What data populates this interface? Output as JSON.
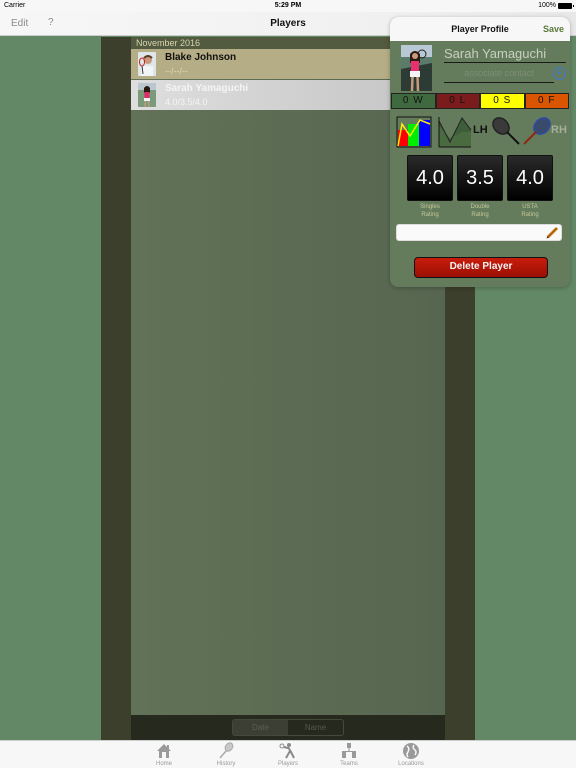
{
  "status_bar": {
    "carrier": "Carrier",
    "time": "5:29 PM",
    "battery": "100%"
  },
  "nav_bar": {
    "edit_label": "Edit",
    "help_label": "?",
    "title": "Players"
  },
  "list": {
    "section_header": "November 2016",
    "rows": [
      {
        "name": "Blake Johnson",
        "subtitle": "--/--/--"
      },
      {
        "name": "Sarah Yamaguchi",
        "subtitle": "4.0/3.5/4.0"
      }
    ]
  },
  "sort_control": {
    "options": [
      "Date",
      "Name"
    ],
    "selected": "Date"
  },
  "tab_bar": {
    "tabs": [
      {
        "label": "Home",
        "icon": "home-icon"
      },
      {
        "label": "History",
        "icon": "racket-icon"
      },
      {
        "label": "Players",
        "icon": "player-icon"
      },
      {
        "label": "Teams",
        "icon": "teams-icon"
      },
      {
        "label": "Locations",
        "icon": "globe-icon"
      }
    ],
    "selected": "Players"
  },
  "profile": {
    "title": "Player Profile",
    "save_label": "Save",
    "name": "Sarah Yamaguchi",
    "contact_placeholder": "associate contact",
    "record": {
      "wins": "0 W",
      "losses": "0 L",
      "sets": "0 S",
      "forfeits": "0 F"
    },
    "record_colors": {
      "wins": "#3f6a3f",
      "losses": "#7a1c1c",
      "sets": "#ffff00",
      "forfeits": "#d95500"
    },
    "hand_left": "LH",
    "hand_right": "RH",
    "selected_hand": "LH",
    "ratings": [
      {
        "value": "4.0",
        "label_line1": "Singles",
        "label_line2": "Rating"
      },
      {
        "value": "3.5",
        "label_line1": "Double",
        "label_line2": "Rating"
      },
      {
        "value": "4.0",
        "label_line1": "USTA",
        "label_line2": "Rating"
      }
    ],
    "notes_value": "",
    "delete_label": "Delete Player"
  }
}
